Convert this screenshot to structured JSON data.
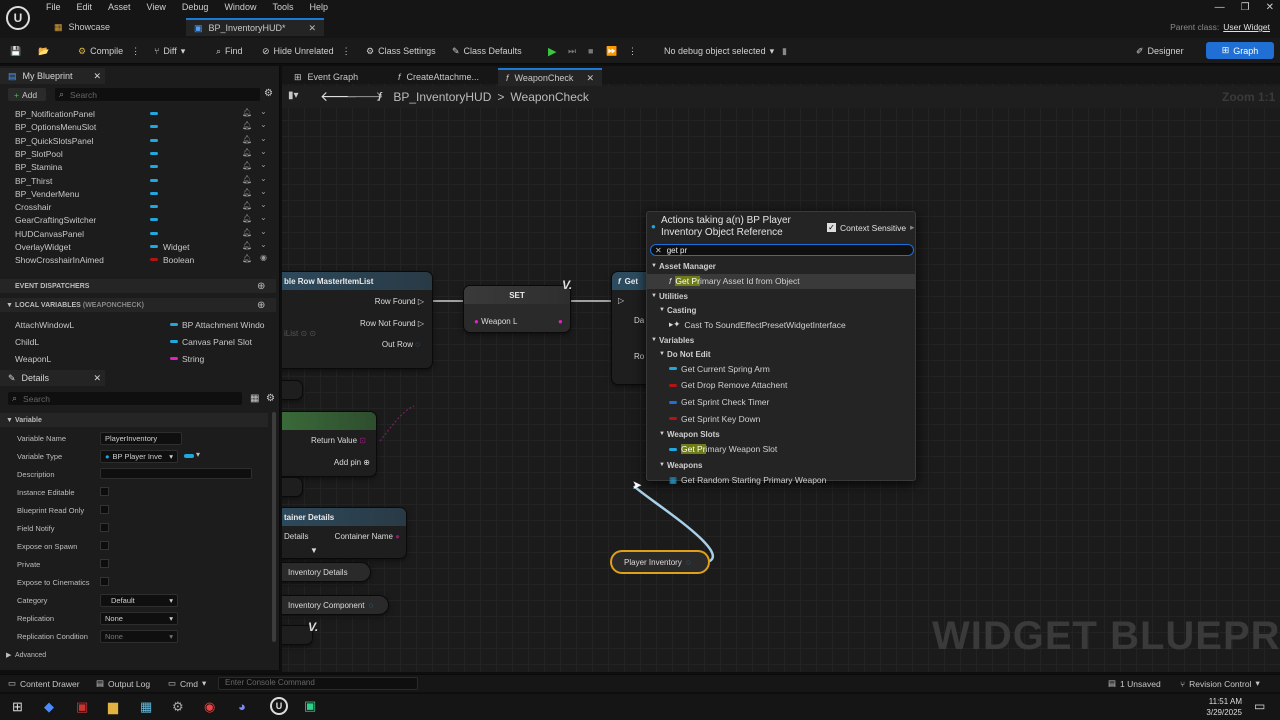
{
  "menu": [
    "File",
    "Edit",
    "Asset",
    "View",
    "Debug",
    "Window",
    "Tools",
    "Help"
  ],
  "tabs": [
    {
      "label": "Showcase"
    },
    {
      "label": "BP_InventoryHUD*"
    }
  ],
  "parent_class": {
    "label": "Parent class:",
    "value": "User Widget"
  },
  "toolbar": {
    "compile": "Compile",
    "diff": "Diff",
    "find": "Find",
    "hide_unrelated": "Hide Unrelated",
    "class_settings": "Class Settings",
    "class_defaults": "Class Defaults",
    "debug_object": "No debug object selected",
    "designer": "Designer",
    "graph": "Graph"
  },
  "my_blueprint": {
    "title": "My Blueprint",
    "add": "Add",
    "search_placeholder": "Search",
    "variables": [
      {
        "name": "BP_NotificationPanel",
        "type": "",
        "color": "#1fa8e0"
      },
      {
        "name": "BP_OptionsMenuSlot",
        "type": "",
        "color": "#1fa8e0"
      },
      {
        "name": "BP_QuickSlotsPanel",
        "type": "",
        "color": "#1fa8e0"
      },
      {
        "name": "BP_SlotPool",
        "type": "",
        "color": "#1fa8e0"
      },
      {
        "name": "BP_Stamina",
        "type": "",
        "color": "#1fa8e0"
      },
      {
        "name": "BP_Thirst",
        "type": "",
        "color": "#1fa8e0"
      },
      {
        "name": "BP_VenderMenu",
        "type": "",
        "color": "#1fa8e0"
      },
      {
        "name": "Crosshair",
        "type": "",
        "color": "#1fa8e0"
      },
      {
        "name": "GearCraftingSwitcher",
        "type": "",
        "color": "#1fa8e0"
      },
      {
        "name": "HUDCanvasPanel",
        "type": "",
        "color": "#1fa8e0"
      },
      {
        "name": "OverlayWidget",
        "type": "Widget",
        "color": "#1fa8e0"
      },
      {
        "name": "ShowCrosshairInAimed",
        "type": "Boolean",
        "color": "#b01414"
      }
    ],
    "event_dispatchers": "EVENT DISPATCHERS",
    "local_variables": "LOCAL VARIABLES",
    "local_scope": "(WEAPONCHECK)",
    "locals": [
      {
        "name": "AttachWindowL",
        "type": "BP Attachment Windo",
        "color": "#1fa8e0"
      },
      {
        "name": "ChildL",
        "type": "Canvas Panel Slot",
        "color": "#1fa8e0"
      },
      {
        "name": "WeaponL",
        "type": "String",
        "color": "#e020c8"
      }
    ]
  },
  "details": {
    "title": "Details",
    "search_placeholder": "Search",
    "section": "Variable",
    "variable_name_label": "Variable Name",
    "variable_name": "PlayerInventory",
    "variable_type_label": "Variable Type",
    "variable_type": "BP Player Inve",
    "description_label": "Description",
    "instance_editable": "Instance Editable",
    "blueprint_read_only": "Blueprint Read Only",
    "field_notify": "Field Notify",
    "expose_on_spawn": "Expose on Spawn",
    "private": "Private",
    "expose_cinematics": "Expose to Cinematics",
    "category_label": "Category",
    "category": "Default",
    "replication_label": "Replication",
    "replication": "None",
    "replication_condition_label": "Replication Condition",
    "replication_condition": "None",
    "advanced": "Advanced"
  },
  "graph_tabs": [
    {
      "label": "Event Graph"
    },
    {
      "label": "CreateAttachme..."
    },
    {
      "label": "WeaponCheck"
    }
  ],
  "breadcrumb": {
    "root": "BP_InventoryHUD",
    "sep": ">",
    "leaf": "WeaponCheck"
  },
  "zoom": "Zoom 1:1",
  "watermark": "WIDGET BLUEPRINT",
  "nodes": {
    "get_row": {
      "title": "ble Row MasterItemList",
      "row_found": "Row Found",
      "row_not_found": "Row Not Found",
      "out_row": "Out Row"
    },
    "set": {
      "title": "SET",
      "pin": "Weapon L"
    },
    "get_partial": "Get",
    "da": "Da",
    "ro": "Ro",
    "make": {
      "return_value": "Return Value",
      "add_pin": "Add pin"
    },
    "container": {
      "title": "tainer Details",
      "details": "Details",
      "container_name": "Container Name"
    },
    "inventory_details": "Inventory Details",
    "inventory_component": "Inventory Component",
    "player_inventory": "Player Inventory"
  },
  "popup": {
    "title": "Actions taking a(n) BP Player Inventory Object Reference",
    "context_sensitive": "Context Sensitive",
    "search": "get pr",
    "items": [
      {
        "kind": "cat",
        "text": "Asset Manager",
        "level": 0
      },
      {
        "kind": "fn",
        "hl": "Get Pr",
        "text": "imary Asset Id from Object",
        "level": 2,
        "selected": true
      },
      {
        "kind": "cat",
        "text": "Utilities",
        "level": 0
      },
      {
        "kind": "cat",
        "text": "Casting",
        "level": 1
      },
      {
        "kind": "fn",
        "hl": "",
        "text": "Cast To SoundEffectPresetWidgetInterface",
        "level": 2
      },
      {
        "kind": "cat",
        "text": "Variables",
        "level": 0
      },
      {
        "kind": "cat",
        "text": "Do Not Edit",
        "level": 1
      },
      {
        "kind": "fn",
        "hl": "",
        "text": "Get Current Spring Arm",
        "level": 2
      },
      {
        "kind": "fn",
        "hl": "",
        "text": "Get Drop Remove Attachent",
        "level": 2
      },
      {
        "kind": "fn",
        "hl": "",
        "text": "Get Sprint Check Timer",
        "level": 2
      },
      {
        "kind": "fn",
        "hl": "",
        "text": "Get Sprint Key Down",
        "level": 2
      },
      {
        "kind": "cat",
        "text": "Weapon Slots",
        "level": 1
      },
      {
        "kind": "fn",
        "hl": "Get Pr",
        "text": "imary Weapon Slot",
        "level": 2
      },
      {
        "kind": "cat",
        "text": "Weapons",
        "level": 1
      },
      {
        "kind": "fn",
        "hl": "",
        "text": "Get Random Starting Primary Weapon",
        "level": 2
      }
    ]
  },
  "status": {
    "content_drawer": "Content Drawer",
    "output_log": "Output Log",
    "cmd": "Cmd",
    "console_placeholder": "Enter Console Command",
    "unsaved": "1 Unsaved",
    "revision": "Revision Control"
  },
  "clock": {
    "time": "11:51 AM",
    "date": "3/29/2025"
  }
}
